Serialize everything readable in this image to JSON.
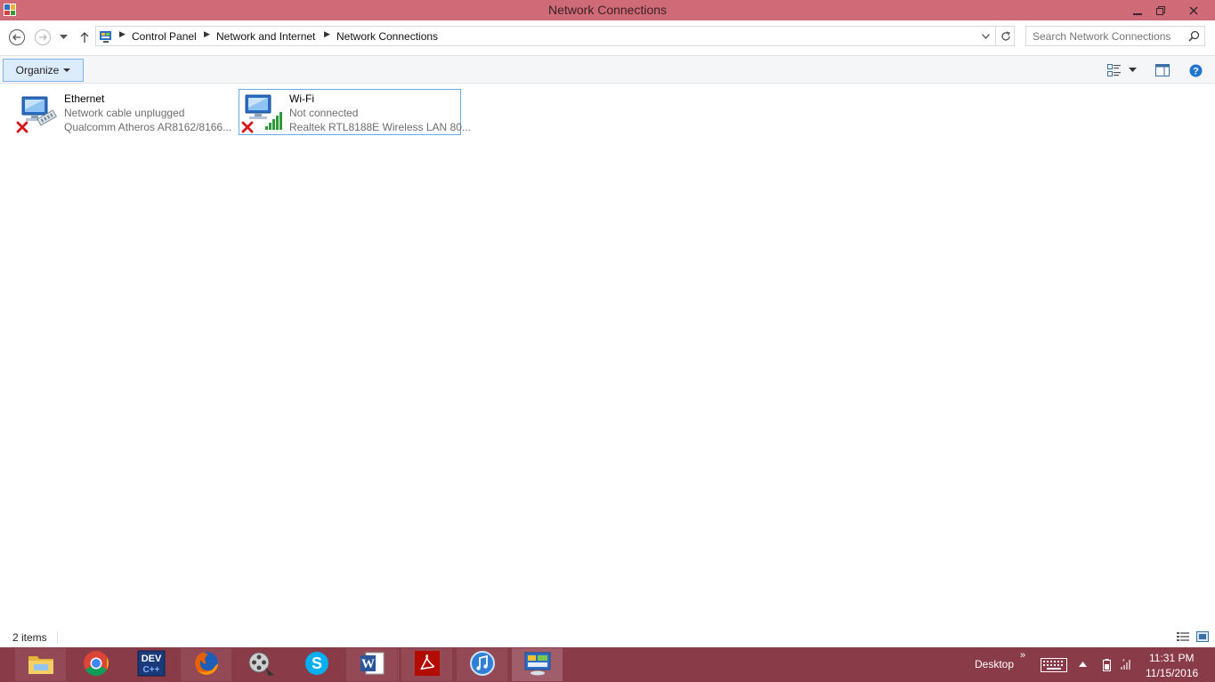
{
  "window": {
    "title": "Network Connections",
    "title_bar_color": "#cf6b77"
  },
  "nav": {
    "back_icon": "back-arrow-icon",
    "forward_icon": "forward-arrow-icon",
    "recent_icon": "chevron-down-icon",
    "up_icon": "up-arrow-icon"
  },
  "address": {
    "breadcrumbs": [
      "Control Panel",
      "Network and Internet",
      "Network Connections"
    ],
    "location_icon": "control-panel-icon",
    "refresh_icon": "refresh-icon"
  },
  "search": {
    "placeholder": "Search Network Connections",
    "icon": "search-icon"
  },
  "toolbar": {
    "organize_label": "Organize",
    "change_view_icon": "change-view-icon",
    "preview_pane_icon": "preview-pane-icon",
    "help_icon": "help-icon"
  },
  "connections": [
    {
      "name": "Ethernet",
      "status": "Network cable unplugged",
      "device": "Qualcomm Atheros AR8162/8166...",
      "icon": "ethernet-adapter-icon",
      "status_icon": "red-x-icon",
      "selected": false
    },
    {
      "name": "Wi-Fi",
      "status": "Not connected",
      "device": "Realtek RTL8188E Wireless LAN 80...",
      "icon": "wifi-adapter-icon",
      "status_icon": "red-x-icon",
      "selected": true
    }
  ],
  "statusbar": {
    "item_count": "2 items"
  },
  "taskbar": {
    "color": "#8a3b48",
    "apps": [
      {
        "name": "File Explorer",
        "icon": "file-explorer-icon"
      },
      {
        "name": "Google Chrome",
        "icon": "chrome-icon"
      },
      {
        "name": "Dev-C++",
        "icon": "dev-cpp-icon",
        "text": "DEV"
      },
      {
        "name": "Firefox",
        "icon": "firefox-icon"
      },
      {
        "name": "Movie Maker",
        "icon": "movie-maker-icon"
      },
      {
        "name": "Skype",
        "icon": "skype-icon"
      },
      {
        "name": "Word",
        "icon": "word-icon",
        "text": "W"
      },
      {
        "name": "Adobe Reader",
        "icon": "adobe-reader-icon"
      },
      {
        "name": "iTunes",
        "icon": "itunes-icon"
      },
      {
        "name": "Control Panel",
        "icon": "control-panel-icon"
      }
    ],
    "desktop_label": "Desktop",
    "time": "11:31 PM",
    "date": "11/15/2016"
  }
}
